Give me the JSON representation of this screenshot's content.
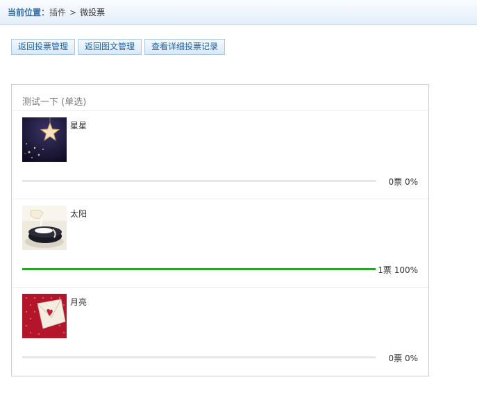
{
  "breadcrumb": {
    "label": "当前位置：",
    "parent": "插件",
    "separator": ">",
    "current": "微投票"
  },
  "buttons": {
    "back_vote_manage": "返回投票管理",
    "back_media_manage": "返回图文管理",
    "view_vote_records": "查看详细投票记录"
  },
  "poll": {
    "title": "测试一下 (单选)",
    "options": [
      {
        "label": "星星",
        "votes_text": "0票",
        "percent_text": "0%",
        "percent": 0,
        "image": "star-image"
      },
      {
        "label": "太阳",
        "votes_text": "1票",
        "percent_text": "100%",
        "percent": 100,
        "image": "cake-image"
      },
      {
        "label": "月亮",
        "votes_text": "0票",
        "percent_text": "0%",
        "percent": 0,
        "image": "envelope-image"
      }
    ]
  },
  "colors": {
    "bar_fill": "#28a428",
    "bar_track": "#e6e6e6",
    "link_blue": "#1e5f9e"
  }
}
